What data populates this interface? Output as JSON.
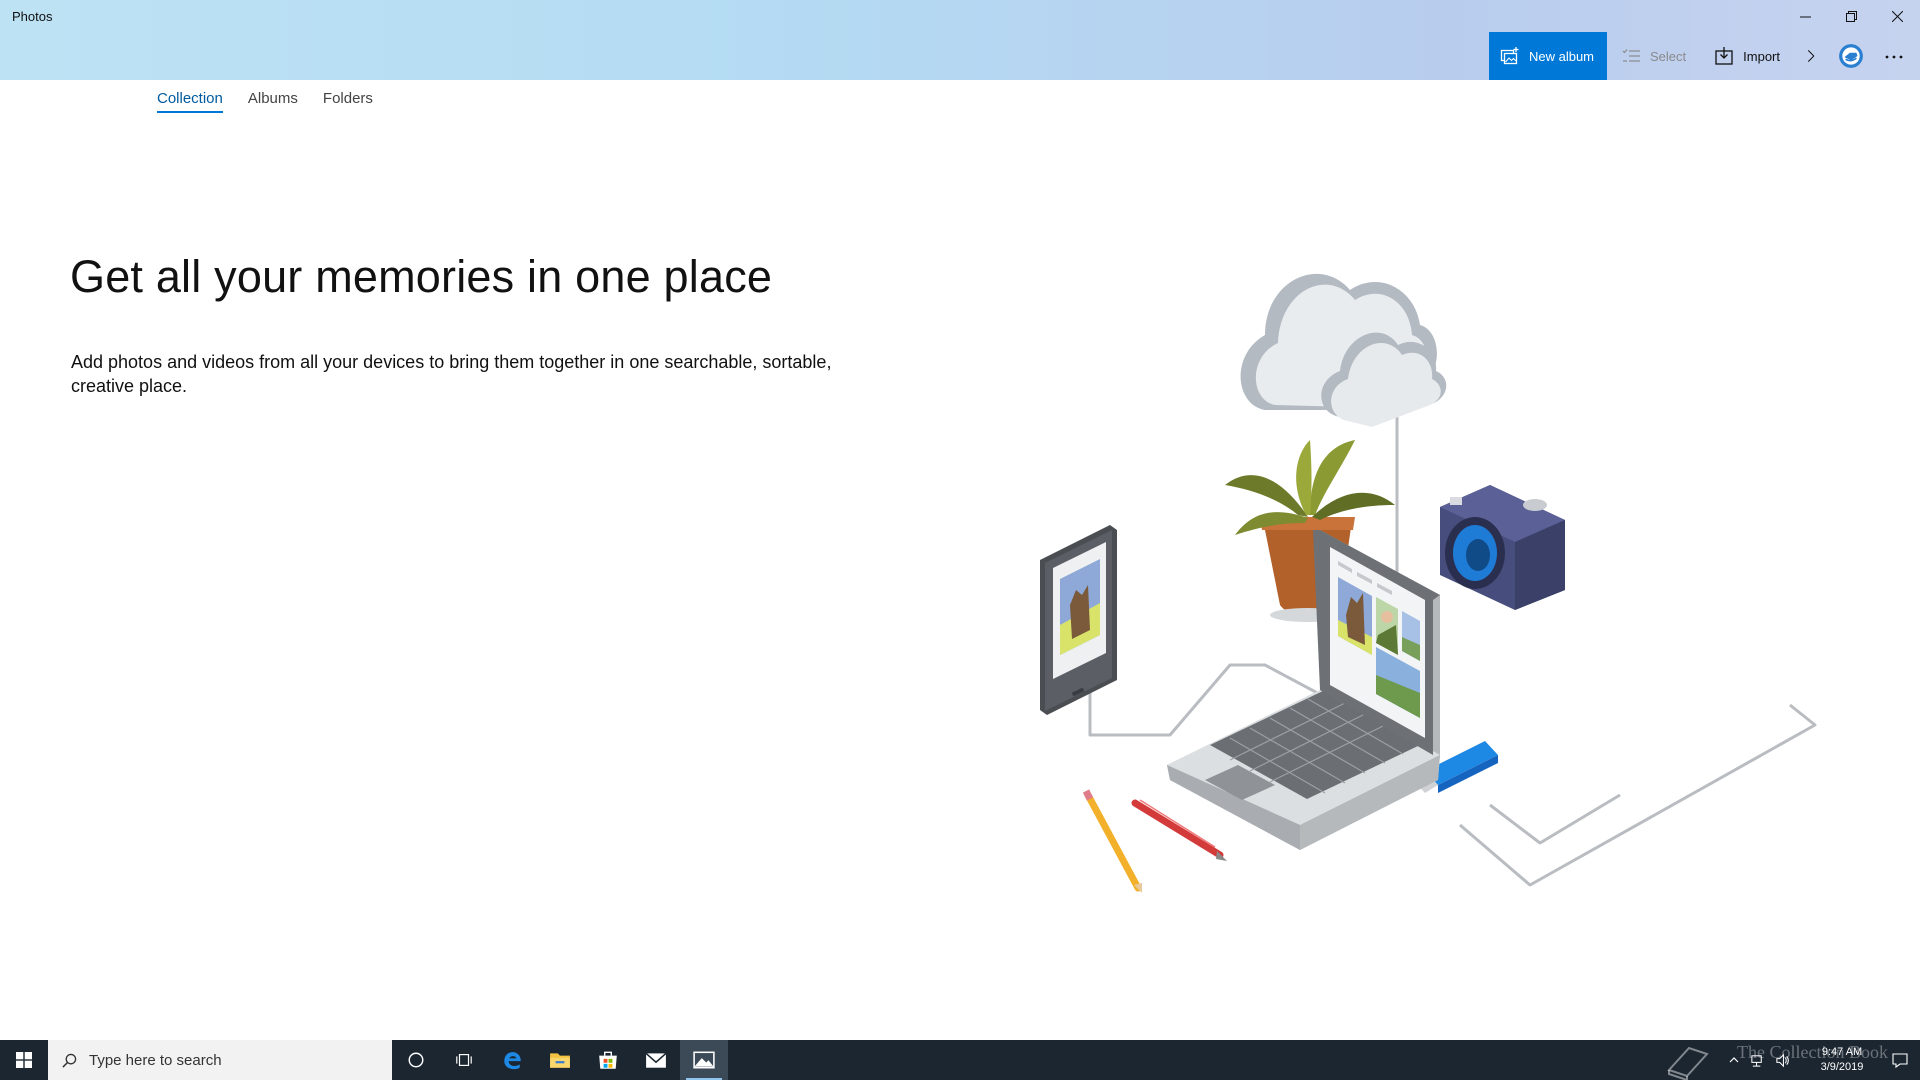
{
  "window": {
    "title": "Photos"
  },
  "commandbar": {
    "new_album_label": "New album",
    "select_label": "Select",
    "import_label": "Import"
  },
  "tabs": [
    {
      "label": "Collection",
      "active": true
    },
    {
      "label": "Albums",
      "active": false
    },
    {
      "label": "Folders",
      "active": false
    }
  ],
  "main": {
    "headline": "Get all your memories in one place",
    "subtext": "Add photos and videos from all your devices to bring them together in one searchable, sortable, creative place."
  },
  "taskbar": {
    "search_placeholder": "Type here to search",
    "time": "9:47 AM",
    "date": "3/9/2019",
    "watermark": "The Collection Book",
    "pinned": [
      "cortana-icon",
      "task-view-icon",
      "edge-icon",
      "file-explorer-icon",
      "store-icon",
      "mail-icon",
      "photos-icon"
    ]
  },
  "colors": {
    "accent": "#0078d7",
    "titlebar_gradient_start": "#bde2f4",
    "taskbar": "#1b2631"
  }
}
